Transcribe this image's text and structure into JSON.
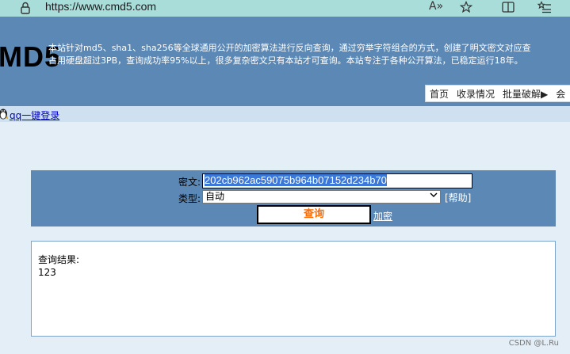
{
  "browser": {
    "url": "https://www.cmd5.com",
    "read_aloud_label": "A»",
    "icons": [
      "lock-icon",
      "read-aloud-icon",
      "favorite-star-icon",
      "split-screen-icon",
      "favorites-list-icon"
    ]
  },
  "header": {
    "logo": "MD5",
    "intro_line1": "本站针对md5、sha1、sha256等全球通用公开的加密算法进行反向查询，通过穷举字符组合的方式，创建了明文密文对应查",
    "intro_line2": "占用硬盘超过3PB，查询成功率95%以上，很多复杂密文只有本站才可查询。本站专注于各种公开算法，已稳定运行18年。",
    "nav": [
      "首页",
      "收录情况",
      "批量破解▶",
      "会"
    ]
  },
  "qq_login": {
    "label": "qq一键登录"
  },
  "query": {
    "cipher_label": "密文:",
    "cipher_value": "202cb962ac59075b964b07152d234b70",
    "type_label": "类型:",
    "type_value": "自动",
    "help_link": "[帮助]",
    "query_button": "查询",
    "encrypt_link": "加密"
  },
  "result": {
    "label": "查询结果:",
    "value": "123"
  },
  "watermark": "CSDN @L.Ru",
  "colors": {
    "header_bg": "#5b88b5",
    "address_bar_bg": "#a9ddd9",
    "page_bg": "#e4eef7",
    "query_button_text": "#ff6a00"
  }
}
